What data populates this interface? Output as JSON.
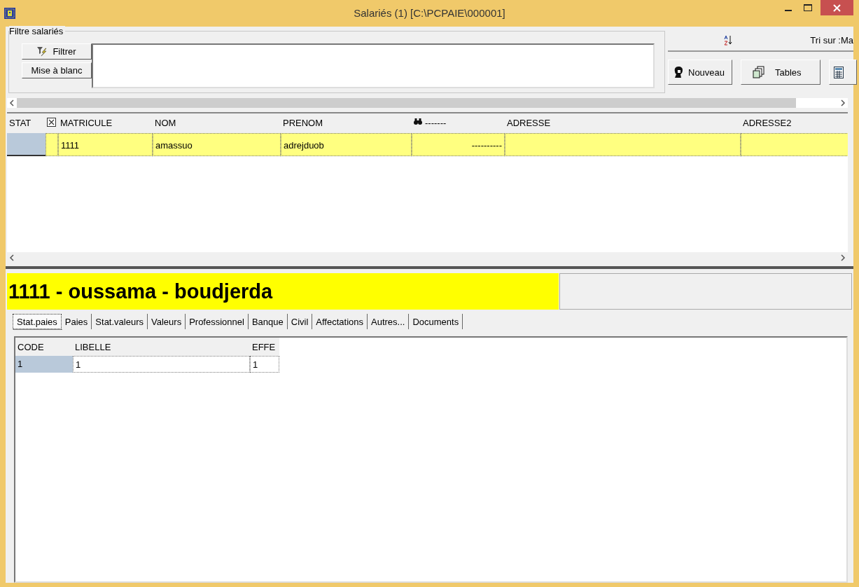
{
  "window": {
    "title": "Salariés (1) [C:\\PCPAIE\\000001]"
  },
  "filter": {
    "group_label": "Filtre salariés",
    "buttons": [
      {
        "label": "Filtrer",
        "kind": "filter"
      },
      {
        "label": "Mise à blanc",
        "kind": "plain"
      }
    ]
  },
  "sort": {
    "label": "Tri sur :Ma"
  },
  "toolbar": [
    {
      "label": "Nouveau",
      "kind": "person"
    },
    {
      "label": "Tables",
      "kind": "copies"
    },
    {
      "kind": "calculator"
    }
  ],
  "grid": {
    "columns": [
      {
        "label": "STAT",
        "kind": "text"
      },
      {
        "kind": "checkbox",
        "checked": true
      },
      {
        "label": "MATRICULE",
        "kind": "text"
      },
      {
        "label": "NOM",
        "kind": "text"
      },
      {
        "label": "PRENOM",
        "kind": "text"
      },
      {
        "label": "-------",
        "kind": "binoculars"
      },
      {
        "label": "ADRESSE",
        "kind": "text"
      },
      {
        "label": "ADRESSE2",
        "kind": "text"
      }
    ],
    "rows": [
      {
        "selected": true,
        "cells": [
          "",
          "",
          "1111",
          "amassuo",
          "adrejduob",
          "----------",
          "",
          ""
        ]
      }
    ]
  },
  "banner": {
    "title": "1111 - oussama - boudjerda"
  },
  "tabs": [
    {
      "label": "Stat.paies",
      "selected": true
    },
    {
      "label": "Paies",
      "selected": false
    },
    {
      "label": "Stat.valeurs",
      "selected": false
    },
    {
      "label": "Valeurs",
      "selected": false
    },
    {
      "label": "Professionnel",
      "selected": false
    },
    {
      "label": "Banque",
      "selected": false
    },
    {
      "label": "Civil",
      "selected": false
    },
    {
      "label": "Affectations",
      "selected": false
    },
    {
      "label": "Autres...",
      "selected": false
    },
    {
      "label": "Documents",
      "selected": false
    }
  ],
  "subgrid": {
    "columns": [
      "CODE",
      "LIBELLE",
      "EFFE"
    ],
    "rows": [
      {
        "cells": [
          "1",
          "1",
          "1"
        ]
      }
    ]
  }
}
